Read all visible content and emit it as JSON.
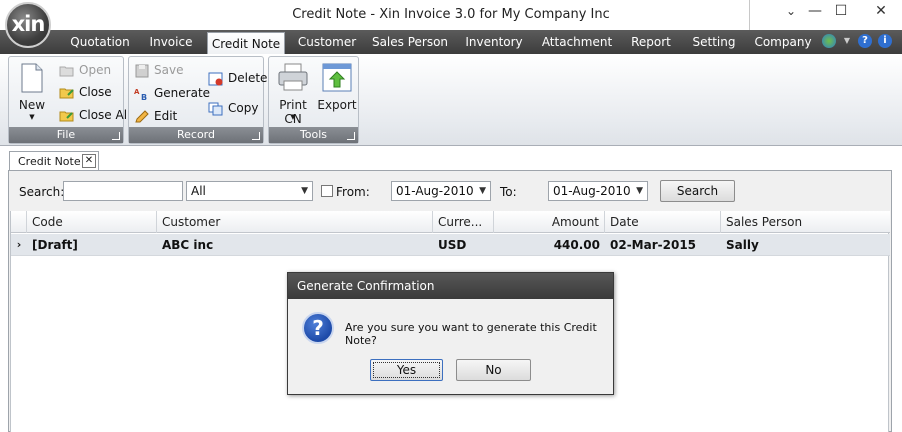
{
  "window": {
    "title": "Credit Note - Xin Invoice 3.0 for My Company Inc",
    "logo_text": "xin",
    "minimize": "—",
    "maximize": "☐",
    "close": "✕",
    "restore_down": "⌄"
  },
  "ribbon_tabs": [
    {
      "label": "Quotation"
    },
    {
      "label": "Invoice"
    },
    {
      "label": "Credit Note"
    },
    {
      "label": "Customer"
    },
    {
      "label": "Sales Person"
    },
    {
      "label": "Inventory"
    },
    {
      "label": "Attachment"
    },
    {
      "label": "Report"
    },
    {
      "label": "Setting"
    },
    {
      "label": "Company"
    }
  ],
  "active_tab": "Credit Note",
  "ribbon": {
    "file": {
      "label": "File",
      "new": "New",
      "open": "Open",
      "close": "Close",
      "close_all": "Close All"
    },
    "record": {
      "label": "Record",
      "save": "Save",
      "generate": "Generate",
      "edit": "Edit",
      "delete": "Delete",
      "copy": "Copy"
    },
    "tools": {
      "label": "Tools",
      "print_cn": "Print CN",
      "export": "Export"
    }
  },
  "document_tab": {
    "label": "Credit Note",
    "close": "✕"
  },
  "filters": {
    "search_label": "Search:",
    "search_value": "",
    "type_value": "All",
    "from_label": "From:",
    "from_checked": false,
    "from_date": "01-Aug-2010",
    "to_label": "To:",
    "to_date": "01-Aug-2010",
    "search_button": "Search"
  },
  "grid": {
    "columns": [
      "Code",
      "Customer",
      "Curre...",
      "Amount",
      "Date",
      "Sales Person"
    ],
    "rows": [
      {
        "indicator": "›",
        "code": "[Draft]",
        "customer": "ABC inc",
        "currency": "USD",
        "amount": "440.00",
        "date": "02-Mar-2015",
        "sales_person": "Sally"
      }
    ]
  },
  "dialog": {
    "title": "Generate Confirmation",
    "icon": "?",
    "message": "Are you sure you want to generate this Credit Note?",
    "yes": "Yes",
    "no": "No"
  },
  "colors": {
    "tabbar": "#3c3c3c",
    "dialog_title": "#3a3a3a",
    "selected_row": "#e2e6eb"
  }
}
